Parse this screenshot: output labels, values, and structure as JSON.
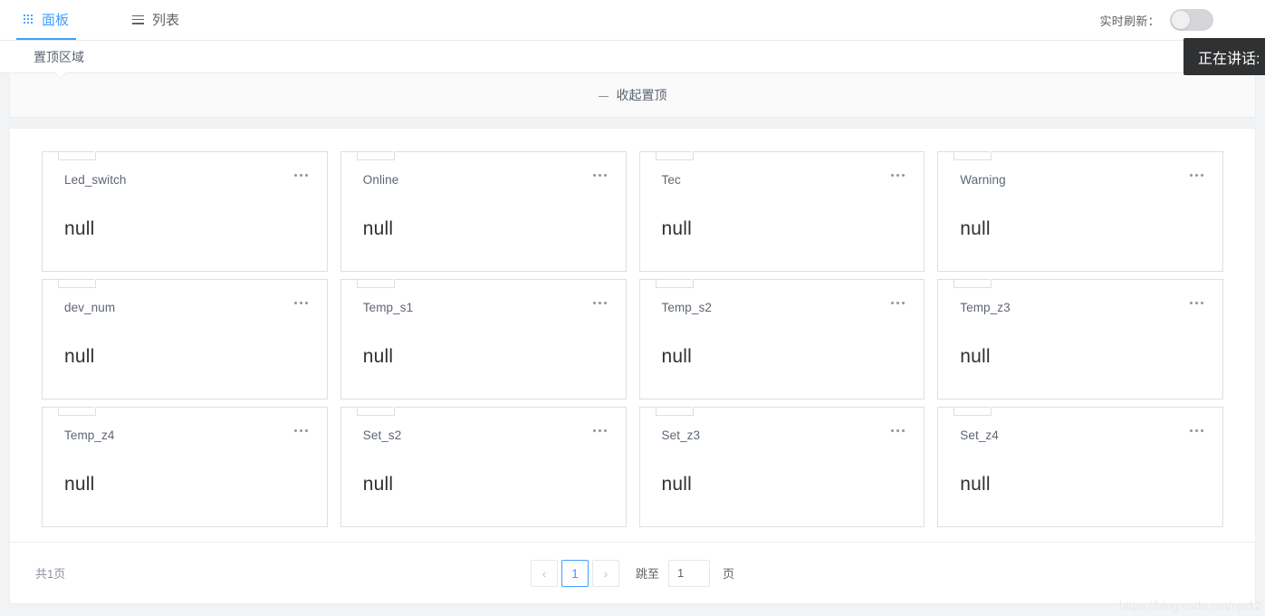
{
  "topbar": {
    "tabs": [
      {
        "label": "面板",
        "icon": "grid-icon",
        "active": true
      },
      {
        "label": "列表",
        "icon": "list-icon",
        "active": false
      }
    ],
    "refresh": {
      "label": "实时刷新：",
      "enabled": false
    }
  },
  "pinned": {
    "title": "置顶区域",
    "collapse_label": "收起置顶",
    "collapse_icon": "minus-icon"
  },
  "cards": [
    {
      "title": "Led_switch",
      "value": "null"
    },
    {
      "title": "Online",
      "value": "null"
    },
    {
      "title": "Tec",
      "value": "null"
    },
    {
      "title": "Warning",
      "value": "null"
    },
    {
      "title": "dev_num",
      "value": "null"
    },
    {
      "title": "Temp_s1",
      "value": "null"
    },
    {
      "title": "Temp_s2",
      "value": "null"
    },
    {
      "title": "Temp_z3",
      "value": "null"
    },
    {
      "title": "Temp_z4",
      "value": "null"
    },
    {
      "title": "Set_s2",
      "value": "null"
    },
    {
      "title": "Set_z3",
      "value": "null"
    },
    {
      "title": "Set_z4",
      "value": "null"
    }
  ],
  "pagination": {
    "total_text": "共1页",
    "prev_icon": "‹",
    "next_icon": "›",
    "current_page": "1",
    "jump_label": "跳至",
    "jump_value": "1",
    "jump_unit": "页"
  },
  "tooltip": {
    "text": "正在讲话: L"
  },
  "watermark": {
    "text": "https://blog.csdn.net/nja12"
  },
  "colors": {
    "accent": "#409eff",
    "page_bg": "#f2f3f5",
    "panel_bg": "#ffffff",
    "border": "#dcdfe6",
    "tooltip_bg": "#303133",
    "text_primary": "#303133",
    "text_secondary": "#606266"
  }
}
